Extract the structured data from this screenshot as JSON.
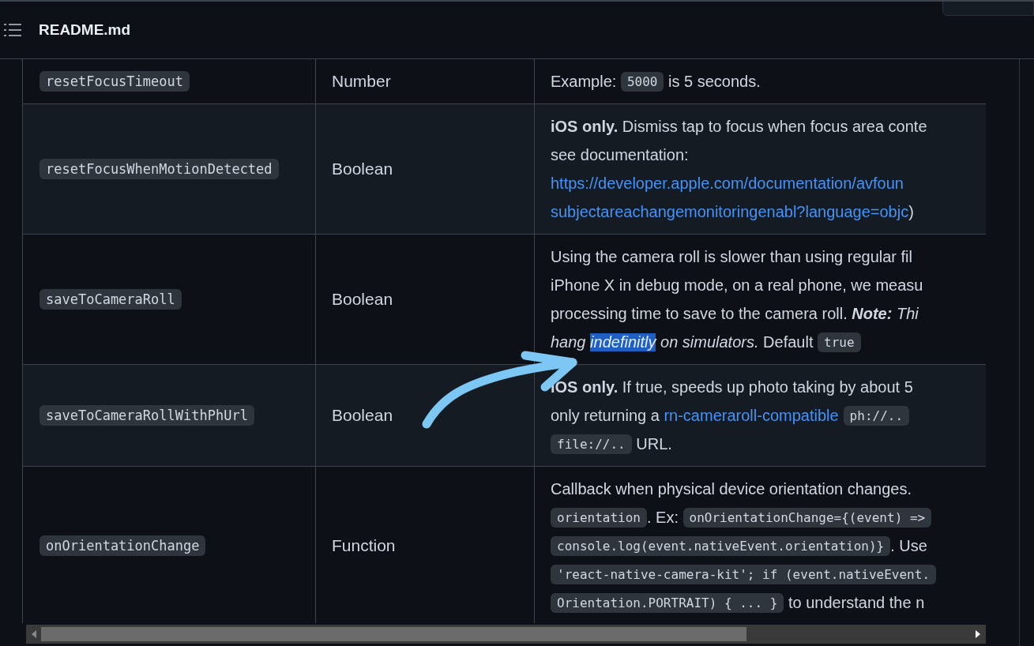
{
  "header": {
    "title": "README.md"
  },
  "table": {
    "rows": [
      {
        "name": "resetFocusTimeout",
        "type": "Number",
        "lines": [
          [
            {
              "kind": "text",
              "text": "Example: "
            },
            {
              "kind": "code",
              "text": "5000"
            },
            {
              "kind": "text",
              "text": " is 5 seconds."
            }
          ]
        ]
      },
      {
        "name": "resetFocusWhenMotionDetected",
        "type": "Boolean",
        "lines": [
          [
            {
              "kind": "bold",
              "text": "iOS only."
            },
            {
              "kind": "text",
              "text": " Dismiss tap to focus when focus area conte"
            }
          ],
          [
            {
              "kind": "text",
              "text": "see documentation:"
            }
          ],
          [
            {
              "kind": "link",
              "text": "https://developer.apple.com/documentation/avfoun"
            }
          ],
          [
            {
              "kind": "link",
              "text": "subjectareachangemonitoringenabl?language=objc"
            },
            {
              "kind": "text",
              "text": ")"
            }
          ]
        ]
      },
      {
        "name": "saveToCameraRoll",
        "type": "Boolean",
        "lines": [
          [
            {
              "kind": "text",
              "text": "Using the camera roll is slower than using regular fil"
            }
          ],
          [
            {
              "kind": "text",
              "text": "iPhone X in debug mode, on a real phone, we measu"
            }
          ],
          [
            {
              "kind": "text",
              "text": "processing time to save to the camera roll. "
            },
            {
              "kind": "bold_italic",
              "text": "Note:"
            },
            {
              "kind": "italic",
              "text": " Thi"
            }
          ],
          [
            {
              "kind": "italic",
              "text": "hang "
            },
            {
              "kind": "selected",
              "text": "indefinitly"
            },
            {
              "kind": "italic",
              "text": " on simulators."
            },
            {
              "kind": "text",
              "text": " Default "
            },
            {
              "kind": "code",
              "text": "true"
            }
          ]
        ]
      },
      {
        "name": "saveToCameraRollWithPhUrl",
        "type": "Boolean",
        "lines": [
          [
            {
              "kind": "bold",
              "text": "iOS only."
            },
            {
              "kind": "text",
              "text": " If true, speeds up photo taking by about 5"
            }
          ],
          [
            {
              "kind": "text",
              "text": "only returning a "
            },
            {
              "kind": "link",
              "text": "rn-cameraroll-compatible"
            },
            {
              "kind": "code",
              "text": "ph://.."
            }
          ],
          [
            {
              "kind": "code",
              "text": "file://.."
            },
            {
              "kind": "text",
              "text": " URL."
            }
          ]
        ]
      },
      {
        "name": "onOrientationChange",
        "type": "Function",
        "lines": [
          [
            {
              "kind": "text",
              "text": "Callback when physical device orientation changes."
            }
          ],
          [
            {
              "kind": "code",
              "text": "orientation"
            },
            {
              "kind": "text",
              "text": ". Ex: "
            },
            {
              "kind": "code",
              "text": "onOrientationChange={(event) =>"
            }
          ],
          [
            {
              "kind": "code",
              "text": "console.log(event.nativeEvent.orientation)}"
            },
            {
              "kind": "text",
              "text": ". Use"
            }
          ],
          [
            {
              "kind": "code",
              "text": "'react-native-camera-kit'; if (event.nativeEvent."
            }
          ],
          [
            {
              "kind": "code",
              "text": "Orientation.PORTRAIT) { ... }"
            },
            {
              "kind": "text",
              "text": " to understand the n"
            }
          ]
        ]
      }
    ]
  }
}
